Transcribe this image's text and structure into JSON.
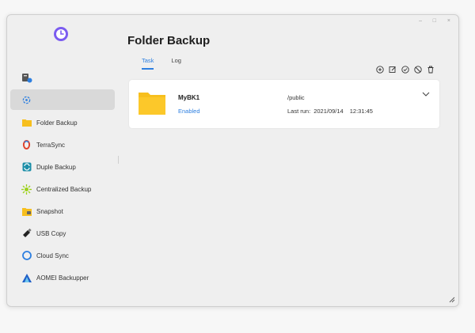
{
  "window": {
    "controls": {
      "minimize": "–",
      "maximize": "□",
      "close": "×"
    }
  },
  "sidebar": {
    "items": [
      {
        "label": "",
        "icon": "sync-icon"
      },
      {
        "label": "Folder Backup",
        "icon": "folder-icon"
      },
      {
        "label": "TerraSync",
        "icon": "terrasync-icon"
      },
      {
        "label": "Duple Backup",
        "icon": "duple-backup-icon"
      },
      {
        "label": "Centralized Backup",
        "icon": "centralized-backup-icon"
      },
      {
        "label": "Snapshot",
        "icon": "snapshot-icon"
      },
      {
        "label": "USB Copy",
        "icon": "usb-copy-icon"
      },
      {
        "label": "Cloud Sync",
        "icon": "cloud-sync-icon"
      },
      {
        "label": "AOMEI Backupper",
        "icon": "aomei-icon"
      }
    ]
  },
  "main": {
    "title": "Folder Backup",
    "tabs": [
      {
        "label": "Task",
        "active": true
      },
      {
        "label": "Log",
        "active": false
      }
    ],
    "toolbar": [
      "add-icon",
      "edit-icon",
      "run-icon",
      "stop-icon",
      "delete-icon"
    ],
    "tasks": [
      {
        "name": "MyBK1",
        "status": "Enabled",
        "path": "/public",
        "last_run_label": "Last run:",
        "last_run_date": "2021/09/14",
        "last_run_time": "12:31:45"
      }
    ]
  },
  "colors": {
    "accent": "#2d7fe0",
    "folder": "#f7bf1e",
    "selected_bg": "#d9d9d9"
  }
}
